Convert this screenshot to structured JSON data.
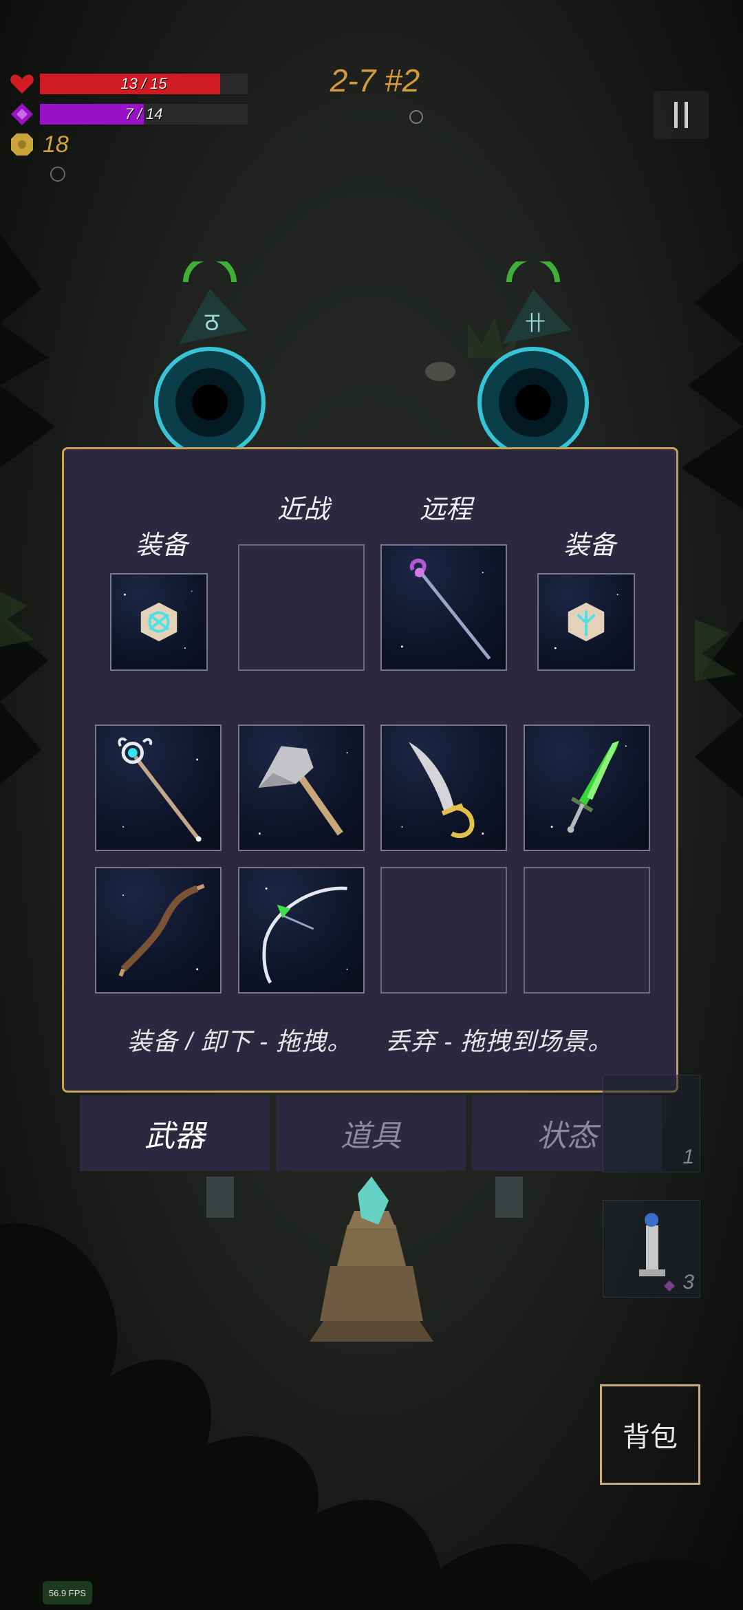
{
  "hud": {
    "health": {
      "current": 13,
      "max": 15,
      "label": "13 / 15",
      "icon": "heart-icon",
      "color": "#d11b22"
    },
    "mana": {
      "current": 7,
      "max": 14,
      "label": "7 / 14",
      "icon": "diamond-icon",
      "color": "#9a12c7"
    },
    "gold": {
      "value": "18",
      "icon": "coin-icon",
      "color": "#d2a441"
    },
    "level": "2-7 #2",
    "pause_icon": "pause-icon"
  },
  "inventory": {
    "headings": {
      "melee": "近战",
      "ranged": "远程",
      "equip_left": "装备",
      "equip_right": "装备"
    },
    "equipped": [
      {
        "slot": "equip-left",
        "item": "rune-stone-icon"
      },
      {
        "slot": "melee",
        "item": null
      },
      {
        "slot": "ranged",
        "item": "purple-staff-icon"
      },
      {
        "slot": "equip-right",
        "item": "rune-stone-icon"
      }
    ],
    "items": [
      [
        "crystal-staff-icon",
        "battle-axe-icon",
        "scimitar-icon",
        "green-sword-icon"
      ],
      [
        "wooden-bow-icon",
        "white-bow-icon",
        null,
        null
      ]
    ],
    "hint_equip": "装备 / 卸下 - 拖拽。",
    "hint_discard": "丢弃 - 拖拽到场景。"
  },
  "tabs": [
    {
      "label": "武器",
      "active": true
    },
    {
      "label": "道具",
      "active": false
    },
    {
      "label": "状态",
      "active": false
    }
  ],
  "side_slots": [
    {
      "count": "1"
    },
    {
      "count": "3"
    }
  ],
  "bag_button": "背包",
  "fps": "56.9 FPS"
}
